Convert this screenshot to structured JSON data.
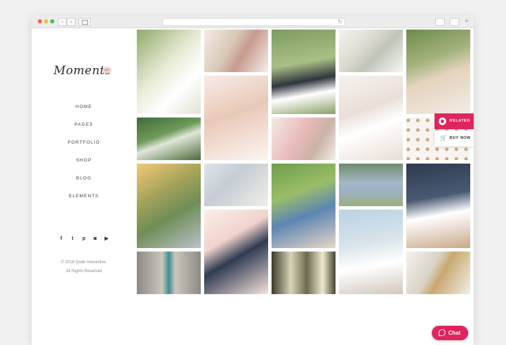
{
  "browser": {
    "back_icon": "‹",
    "forward_icon": "›",
    "reload_icon": "↻",
    "new_tab_icon": "+"
  },
  "brand": {
    "logo_text": "Moments",
    "badge_text": "WP"
  },
  "menu": {
    "items": [
      "HOME",
      "PAGES",
      "PORTFOLIO",
      "SHOP",
      "BLOG",
      "ELEMENTS"
    ]
  },
  "social": {
    "icons": [
      {
        "name": "facebook-icon",
        "glyph": "f"
      },
      {
        "name": "twitter-icon",
        "glyph": "t"
      },
      {
        "name": "pinterest-icon",
        "glyph": "p"
      },
      {
        "name": "instagram-icon",
        "glyph": "◙"
      },
      {
        "name": "youtube-icon",
        "glyph": "▶"
      }
    ]
  },
  "footer": {
    "copyright_line1": "© 2016 Qode Interactive.",
    "copyright_line2": "All Rights Reserved"
  },
  "side_widget": {
    "related_label": "RELATED",
    "buy_now_label": "BUY NOW",
    "cart_icon": "🛒"
  },
  "chat": {
    "label": "Chat"
  },
  "colors": {
    "accent": "#e0245e",
    "text": "#3a3a3a",
    "muted": "#8d8d8d"
  },
  "gallery": {
    "photos": [
      "bridal-bouquet-white-roses",
      "hanging-flowers-cords",
      "couple-in-park",
      "bouquet-in-glass",
      "bride-hair-flowers-back",
      "bride-portrait-flower-crown",
      "couple-forest-path",
      "bride-holding-bouquet",
      "bride-in-white-room",
      "wooden-beads-pattern",
      "couple-sunlit-trees",
      "bride-shoulder-closeup",
      "couple-laughing-outdoors",
      "bridesmaids-group",
      "couple-walking-dock",
      "couple-embracing-blush",
      "groom-tie-boutonniere",
      "hanging-floral-glass-decor",
      "bride-running-dress",
      "table-setting-glasses"
    ]
  }
}
